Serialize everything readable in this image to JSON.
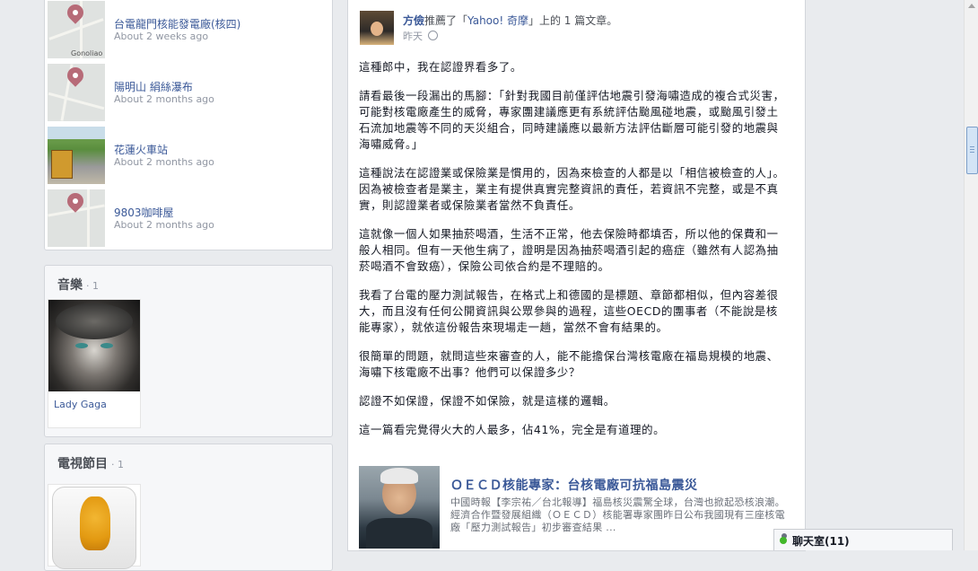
{
  "places": [
    {
      "title": "台電龍門核能發電廠(核四)",
      "time": "About 2 weeks ago",
      "map_label": "Gonoliao"
    },
    {
      "title": "陽明山 絹絲瀑布",
      "time": "About 2 months ago"
    },
    {
      "title": "花蓮火車站",
      "time": "About 2 months ago"
    },
    {
      "title": "9803咖啡屋",
      "time": "About 2 months ago"
    }
  ],
  "music": {
    "title": "音樂",
    "count": "· 1",
    "item": "Lady Gaga"
  },
  "tv": {
    "title": "電視節目",
    "count": "· 1"
  },
  "post": {
    "author": "方儉",
    "action_pre": "推薦了「",
    "source": "Yahoo! 奇摩",
    "action_post": "」上的 1 篇文章。",
    "time": "昨天",
    "paragraphs": [
      "這種郎中，我在認證界看多了。",
      "請看最後一段漏出的馬腳：「針對我國目前僅評估地震引發海嘯造成的複合式災害，可能對核電廠產生的威脅，專家團建議應更有系統評估颱風碰地震，或颱風引發土石流加地震等不同的天災組合，同時建議應以最新方法評估斷層可能引發的地震與海嘯威脅。」",
      "這種說法在認證業或保險業是慣用的，因為來檢查的人都是以「相信被檢查的人」。因為被檢查者是業主，業主有提供真實完整資訊的責任，若資訊不完整，或是不真實，則認證業者或保險業者當然不負責任。",
      "這就像一個人如果抽菸喝酒，生活不正常，他去保險時都填否，所以他的保費和一般人相同。但有一天他生病了，證明是因為抽菸喝酒引起的癌症（雖然有人認為抽菸喝酒不會致癌），保險公司依合約是不理賠的。",
      "我看了台電的壓力測試報告，在格式上和德國的是標題、章節都相似，但內容差很大，而且沒有任何公開資訊與公眾參與的過程，這些OECD的團事者（不能說是核能專家），就依這份報告來現場走一趟，當然不會有結果的。",
      "很簡單的問題，就問這些來審查的人，能不能擔保台灣核電廠在福島規模的地震、海嘯下核電廠不出事？他們可以保證多少？",
      "認證不如保證，保證不如保險，就是這樣的邏輯。",
      "這一篇看完覺得火大的人最多，佔41%，完全是有道理的。"
    ],
    "link": {
      "title": "ＯＥＣＤ核能專家：台核電廠可抗福島震災",
      "description": "中國時報【李宗祐／台北報導】福島核災震驚全球，台灣也掀起恐核浪潮。經濟合作暨發展組織（ＯＥＣＤ）核能署專家團昨日公布我國現有三座核電廠「壓力測試報告」初步審查結果 ..."
    }
  },
  "chat": {
    "label": "聊天室(11)"
  }
}
